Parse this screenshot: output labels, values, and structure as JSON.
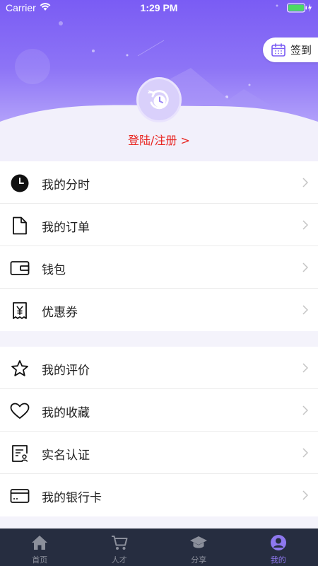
{
  "status_bar": {
    "carrier": "Carrier",
    "time": "1:29 PM"
  },
  "header": {
    "checkin_label": "签到",
    "login_text": "登陆/注册 >"
  },
  "menu_group_1": [
    {
      "label": "我的分时",
      "icon": "clock-icon"
    },
    {
      "label": "我的订单",
      "icon": "document-icon"
    },
    {
      "label": "钱包",
      "icon": "wallet-icon"
    },
    {
      "label": "优惠券",
      "icon": "coupon-icon"
    }
  ],
  "menu_group_2": [
    {
      "label": "我的评价",
      "icon": "star-icon"
    },
    {
      "label": "我的收藏",
      "icon": "heart-icon"
    },
    {
      "label": "实名认证",
      "icon": "id-card-icon"
    },
    {
      "label": "我的银行卡",
      "icon": "bank-card-icon"
    }
  ],
  "tabbar": {
    "items": [
      {
        "label": "首页",
        "icon": "home-icon"
      },
      {
        "label": "人才",
        "icon": "cart-icon"
      },
      {
        "label": "分享",
        "icon": "graduation-cap-icon"
      },
      {
        "label": "我的",
        "icon": "user-icon"
      }
    ],
    "active_index": 3
  },
  "colors": {
    "accent": "#8e78ef",
    "header_gradient_top": "#7a5cf4",
    "login_text": "#e8231f",
    "tabbar_bg": "#262d40"
  }
}
